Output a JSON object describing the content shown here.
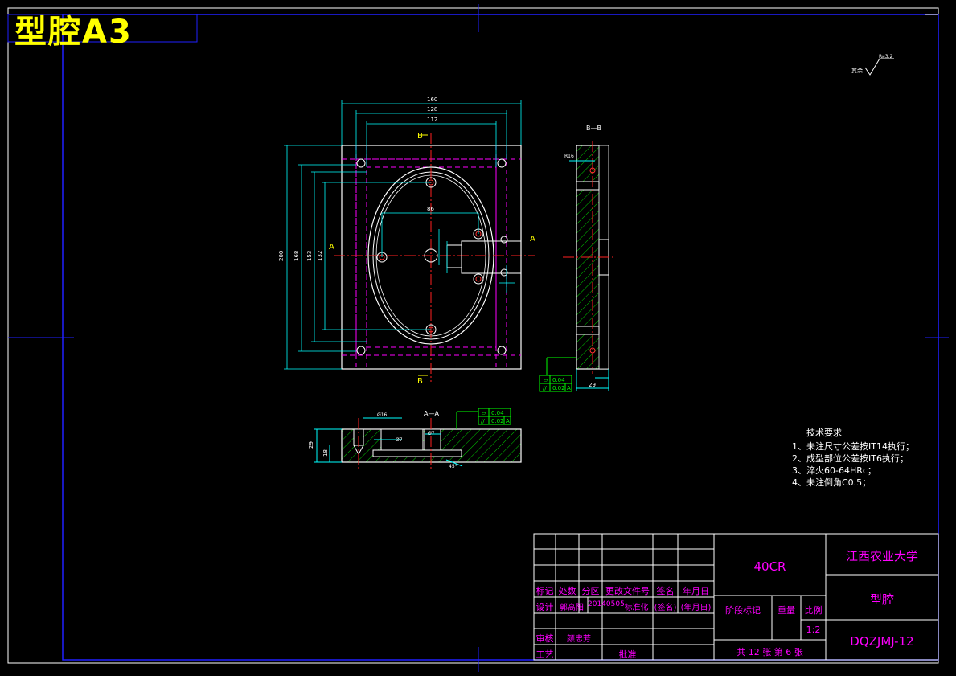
{
  "drawing_title": "型腔A3",
  "surface_roughness_label": "其余",
  "surface_roughness_value": "Ra3.2",
  "views": {
    "section_a_label": "A—A",
    "section_b_label": "B—B",
    "cut_marker_b": "B",
    "cut_marker_a": "A"
  },
  "dimensions": {
    "plate_width": "160",
    "inner_width_1": "128",
    "inner_width_2": "112",
    "plate_height": "200",
    "inner_height_1": "168",
    "inner_height_2": "153",
    "inner_height_3": "132",
    "ellipse_dim": "86",
    "side_thickness": "29",
    "side_top": "R16",
    "section_height": "29",
    "section_depth": "18",
    "section_d1": "Ø16",
    "section_d2": "Ø7",
    "section_d3": "Ø7",
    "section_angle": "45°"
  },
  "tolerance_frames": {
    "frame_1": [
      "0.04",
      "0.02",
      "A"
    ],
    "frame_2": [
      "0.04",
      "0.02",
      "A"
    ]
  },
  "tech_requirements": {
    "heading": "技术要求",
    "items": [
      "1、未注尺寸公差按IT14执行；",
      "2、成型部位公差按IT6执行；",
      "3、淬火60-64HRc；",
      "4、未注倒角C0.5；"
    ]
  },
  "title_block": {
    "material": "40CR",
    "school": "江西农业大学",
    "part_name": "型腔",
    "drawing_no": "DQZJMJ-12",
    "scale_label": "比例",
    "scale_value": "1:2",
    "stage_label": "阶段标记",
    "weight_label": "重量",
    "sheets": "共 12 张 第 6 张",
    "row_headers": [
      "标记",
      "处数",
      "分区",
      "更改文件号",
      "签名",
      "年月日"
    ],
    "design_label": "设计",
    "designer": "郭高阳",
    "design_date": "20140505",
    "standardize_label": "标准化",
    "sign_placeholder": "(签名)",
    "date_placeholder": "(年月日)",
    "review_label": "审核",
    "reviewer": "颜忠芳",
    "process_label": "工艺",
    "approve_label": "批准"
  }
}
